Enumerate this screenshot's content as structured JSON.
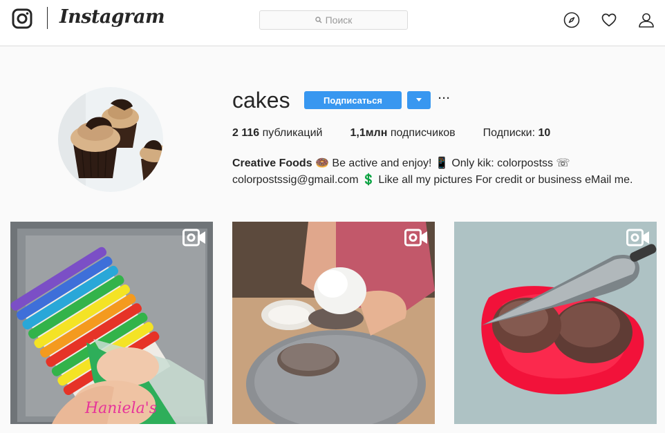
{
  "nav": {
    "wordmark": "Instagram",
    "search_placeholder": "Поиск",
    "icons": [
      "instagram-camera-icon",
      "search-icon",
      "explore-compass-icon",
      "heart-icon",
      "profile-person-icon"
    ]
  },
  "profile": {
    "username": "cakes",
    "follow_label": "Подписаться",
    "more_label": "···",
    "stats": {
      "posts_count": "2 116",
      "posts_label": "публикаций",
      "followers_count": "1,1млн",
      "followers_label": "подписчиков",
      "following_label": "Подписки:",
      "following_count": "10"
    },
    "bio": {
      "name": "Creative Foods",
      "line1": " 🍩 Be active and enjoy! 📱 Only kik: colorpostss ☏",
      "line2": "colorpostssig@gmail.com 💲 Like all my pictures For credit or business eMail me."
    }
  },
  "posts": [
    {
      "type": "video",
      "watermark": "Haniela's"
    },
    {
      "type": "video"
    },
    {
      "type": "video"
    }
  ],
  "colors": {
    "accent": "#3897f0",
    "text": "#262626",
    "border": "#dbdbdb",
    "background": "#fafafa"
  }
}
